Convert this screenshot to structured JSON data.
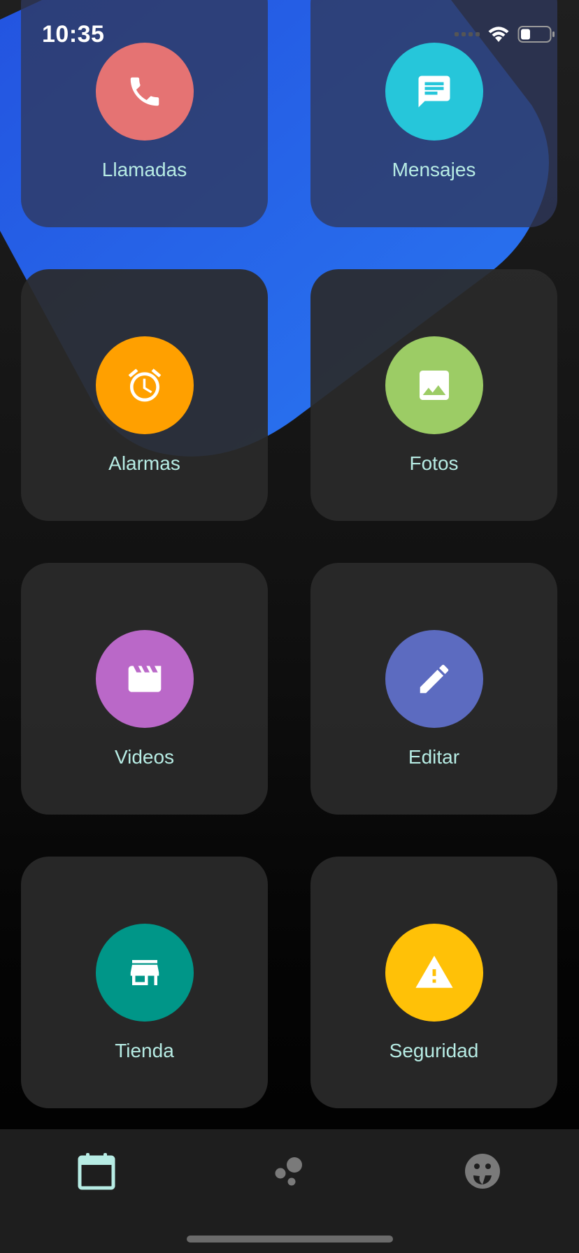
{
  "status_bar": {
    "time": "10:35"
  },
  "tiles": [
    {
      "label": "Llamadas",
      "icon": "phone-icon",
      "color": "#e57373"
    },
    {
      "label": "Mensajes",
      "icon": "message-icon",
      "color": "#26c6da"
    },
    {
      "label": "Alarmas",
      "icon": "alarm-icon",
      "color": "#ffa000"
    },
    {
      "label": "Fotos",
      "icon": "image-icon",
      "color": "#9ccc65"
    },
    {
      "label": "Videos",
      "icon": "movie-icon",
      "color": "#ba68c8"
    },
    {
      "label": "Editar",
      "icon": "pencil-icon",
      "color": "#5c6bc0"
    },
    {
      "label": "Tienda",
      "icon": "store-icon",
      "color": "#009688"
    },
    {
      "label": "Seguridad",
      "icon": "warning-icon",
      "color": "#ffc107"
    }
  ],
  "bottom_nav": {
    "items": [
      {
        "icon": "calendar-icon",
        "active": true
      },
      {
        "icon": "bubbles-icon",
        "active": false
      },
      {
        "icon": "face-icon",
        "active": false
      }
    ],
    "active_color": "#b7ece4",
    "inactive_color": "#7a7a7a"
  },
  "theme": {
    "accent_blue": "#2a6bf0",
    "label_color": "#b7ece4"
  }
}
